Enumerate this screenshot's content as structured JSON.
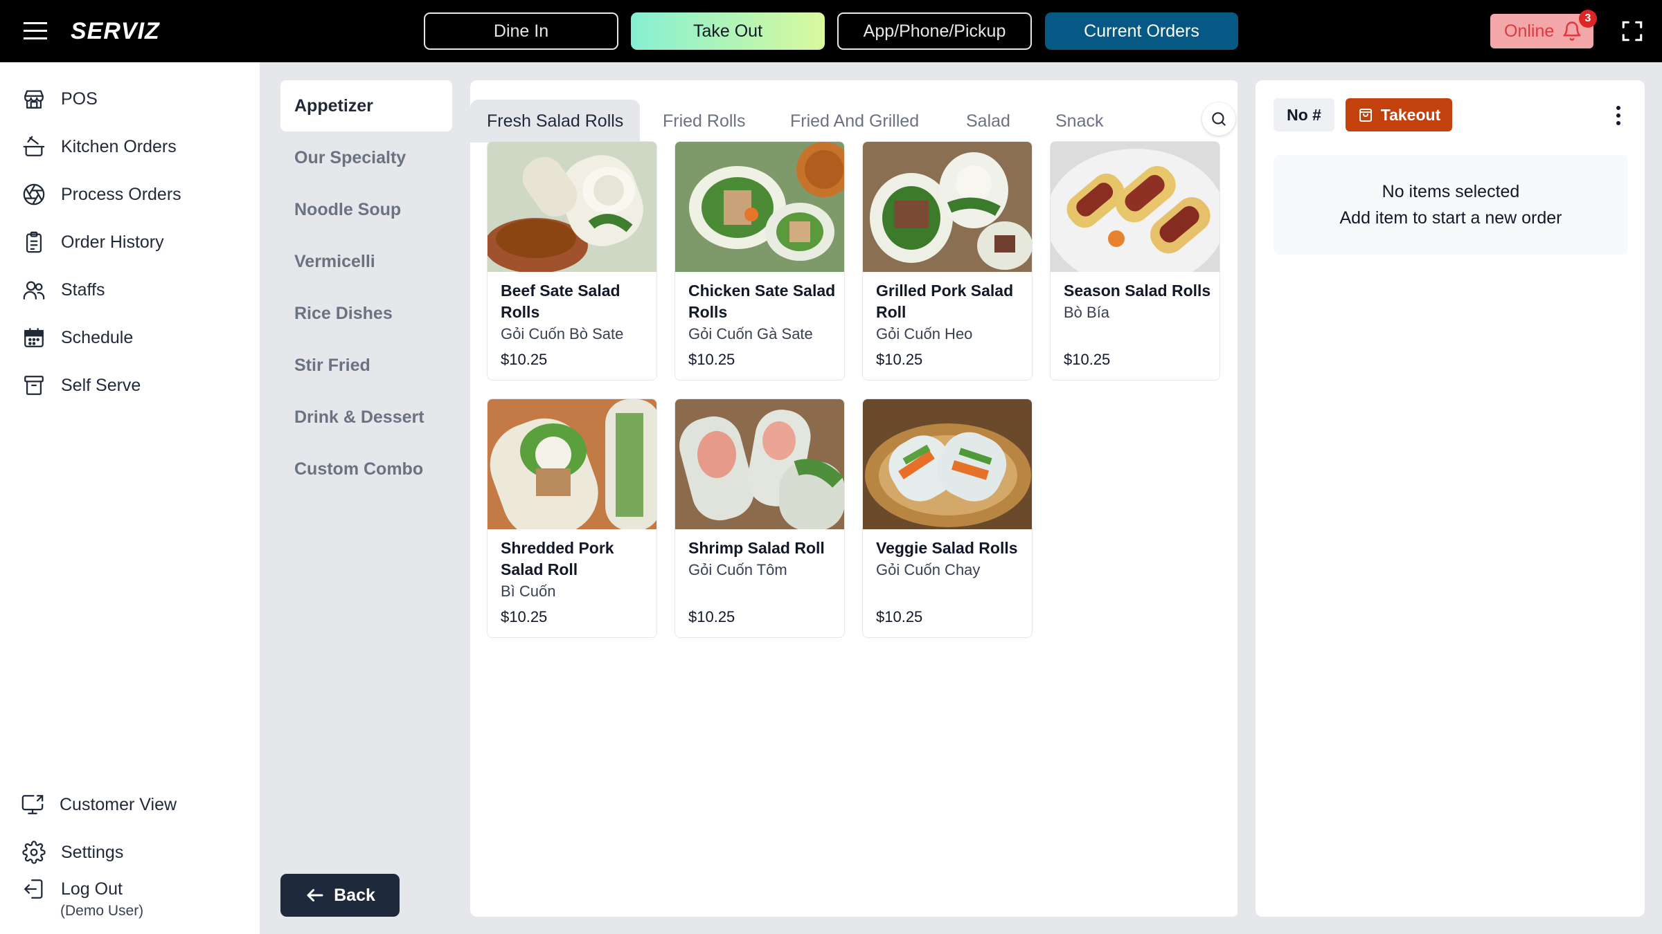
{
  "app": {
    "logo": "SERVIZ"
  },
  "modes": {
    "dine_in": "Dine In",
    "take_out": "Take Out",
    "app_phone_pickup": "App/Phone/Pickup",
    "current_orders": "Current Orders"
  },
  "status": {
    "online_label": "Online",
    "notification_count": "3"
  },
  "nav": {
    "items": [
      {
        "label": "POS",
        "icon": "store-icon"
      },
      {
        "label": "Kitchen Orders",
        "icon": "cooking-pot-icon"
      },
      {
        "label": "Process Orders",
        "icon": "aperture-icon"
      },
      {
        "label": "Order History",
        "icon": "clipboard-list-icon"
      },
      {
        "label": "Staffs",
        "icon": "users-icon"
      },
      {
        "label": "Schedule",
        "icon": "calendar-icon"
      },
      {
        "label": "Self Serve",
        "icon": "archive-box-icon"
      }
    ],
    "bottom": {
      "customer_view": "Customer View",
      "settings": "Settings",
      "logout": "Log Out",
      "user": "(Demo User)"
    }
  },
  "categories": [
    "Appetizer",
    "Our Specialty",
    "Noodle Soup",
    "Vermicelli",
    "Rice Dishes",
    "Stir Fried",
    "Drink & Dessert",
    "Custom Combo"
  ],
  "active_category": "Appetizer",
  "back_label": "Back",
  "subtabs": [
    "Fresh Salad Rolls",
    "Fried Rolls",
    "Fried And Grilled",
    "Salad",
    "Snack"
  ],
  "active_subtab": "Fresh Salad Rolls",
  "menu_items": [
    {
      "name": "Beef Sate Salad Rolls",
      "subtitle": "Gỏi Cuốn Bò Sate",
      "price": "$10.25"
    },
    {
      "name": "Chicken Sate Salad Rolls",
      "subtitle": "Gỏi Cuốn Gà Sate",
      "price": "$10.25"
    },
    {
      "name": "Grilled Pork Salad Roll",
      "subtitle": "Gỏi Cuốn Heo",
      "price": "$10.25"
    },
    {
      "name": "Season Salad Rolls",
      "subtitle": "Bò Bía",
      "price": "$10.25"
    },
    {
      "name": "Shredded Pork Salad Roll",
      "subtitle": "Bì Cuốn",
      "price": "$10.25"
    },
    {
      "name": "Shrimp Salad Roll",
      "subtitle": "Gỏi Cuốn Tôm",
      "price": "$10.25"
    },
    {
      "name": "Veggie Salad Rolls",
      "subtitle": "Gỏi Cuốn Chay",
      "price": "$10.25"
    }
  ],
  "order": {
    "number_label": "No #",
    "type_label": "Takeout",
    "empty_line1": "No items selected",
    "empty_line2": "Add item to start a new order"
  },
  "colors": {
    "topbar": "#000000",
    "take_out_gradient_start": "#86efd3",
    "take_out_gradient_end": "#d9f99d",
    "current_orders": "#075985",
    "online_bg": "#f4a7a9",
    "online_text": "#e0383e",
    "takeout_button": "#c2410c",
    "back_button": "#1e293b",
    "panel_bg": "#e5e7eb"
  }
}
